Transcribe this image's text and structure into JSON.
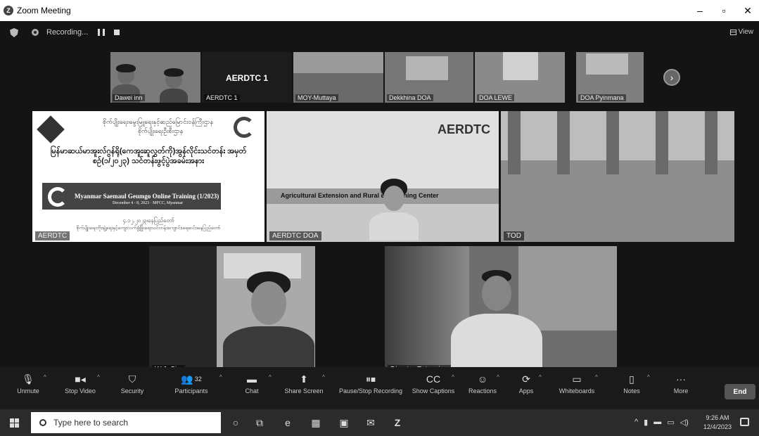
{
  "window": {
    "title": "Zoom Meeting"
  },
  "recording": {
    "label": "Recording..."
  },
  "view": {
    "label": "View"
  },
  "thumbnails": [
    {
      "label": "Dawei  inn"
    },
    {
      "label": "AERDTC 1",
      "big": "AERDTC 1"
    },
    {
      "label": "MOY-Muttaya"
    },
    {
      "label": "Dekkhina DOA"
    },
    {
      "label": "DOA LEWE"
    },
    {
      "label": "DOA Pyinmana"
    }
  ],
  "tiles": {
    "slide": {
      "label": "AERDTC",
      "m1": " စိုက်ပျိုးရေး၊မွေးမြူရေးနှင့်ဆည်မြောင်းဝန်ကြီးဌာန",
      "m2": "စိုက်ပျိုးရေးဦးစီးဌာန",
      "heading": "မြန်မာဆယ်မာအူးလ်ဂွန်ရို(ကေအူးဆူလွှတ်ကို)အွန်လိုင်းသင်တန်း အမှတ်စဉ်(၁/၂၀၂၃) သင်တန်းဖွင့်ပွဲအခမ်းအနား",
      "banner": "Myanmar Saemaul Geumgo Online Training (1/2023)",
      "banner_sub": "December 4 - 8, 2023 · MFCC, Myanmar",
      "footer1": "၄.၁၂.၂၀၂၃၊နေပြည်တော်",
      "footer2": "စိုက်ပျိုးရေးတိုးချဲ့ရေးနှင့်ကျေးလက်ဖွံ့ဖြိုးရေးသင်တန်းကျောင်း၊ရေဆင်း၊နေပြည်တော်"
    },
    "aerdtc": {
      "label": "AERDTC DOA",
      "brand": "AERDTC",
      "caption": "Agricultural Extension and Rural        ent Training Center"
    },
    "hall": {
      "label": "TOD"
    },
    "cam1": {
      "label": "W.J. Sim"
    },
    "cam2": {
      "label": "Director Extension"
    }
  },
  "toolbar": {
    "unmute": "Unmute",
    "stop_video": "Stop Video",
    "security": "Security",
    "participants": "Participants",
    "participants_count": "32",
    "chat": "Chat",
    "share_screen": "Share Screen",
    "pause_stop_recording": "Pause/Stop Recording",
    "show_captions": "Show Captions",
    "reactions": "Reactions",
    "apps": "Apps",
    "whiteboards": "Whiteboards",
    "notes": "Notes",
    "more": "More",
    "end": "End"
  },
  "taskbar": {
    "search_placeholder": "Type here to search",
    "time": "9:26 AM",
    "date": "12/4/2023"
  },
  "icons": [
    "zoom-logo-icon",
    "shield-icon",
    "record-icon",
    "pause-icon",
    "stop-icon",
    "mic-muted-icon",
    "video-icon",
    "security-icon",
    "participants-icon",
    "chat-icon",
    "share-icon",
    "captions-icon",
    "reactions-icon",
    "apps-icon",
    "whiteboard-icon",
    "notes-icon",
    "more-icon",
    "windows-icon",
    "search-icon",
    "chevron-right-icon"
  ]
}
